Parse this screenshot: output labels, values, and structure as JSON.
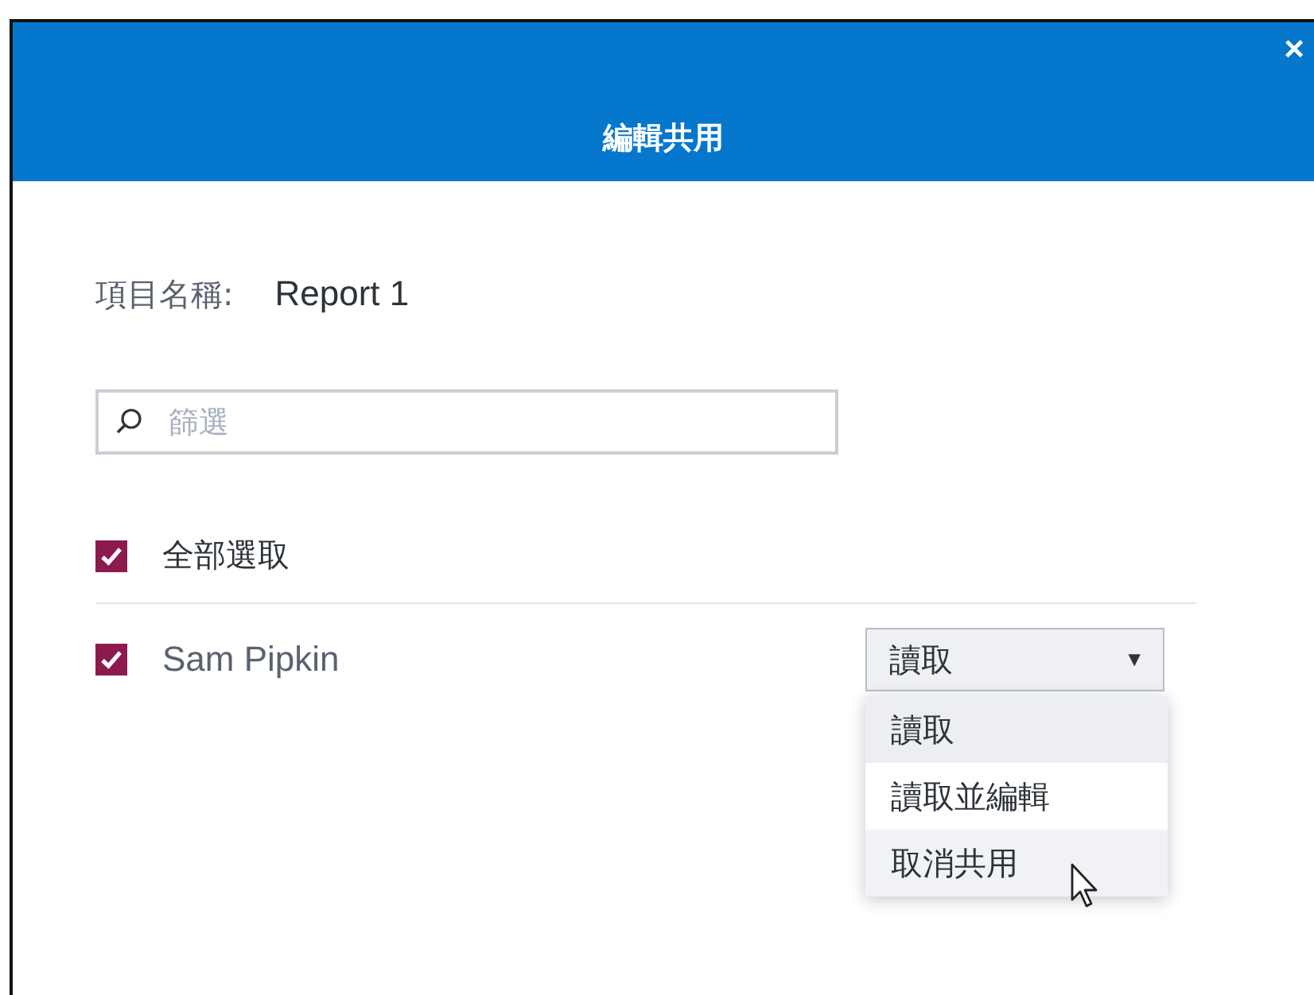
{
  "dialog": {
    "title": "編輯共用",
    "close": "×"
  },
  "item_name": {
    "label": "項目名稱:",
    "value": "Report 1"
  },
  "filter": {
    "placeholder": "篩選"
  },
  "select_all": {
    "label": "全部選取",
    "checked": true
  },
  "users": [
    {
      "name": "Sam Pipkin",
      "checked": true,
      "permission": "讀取",
      "caret": "▼",
      "expanded": true,
      "options": [
        {
          "label": "讀取",
          "selected": true,
          "hovered": false
        },
        {
          "label": "讀取並編輯",
          "selected": false,
          "hovered": false
        },
        {
          "label": "取消共用",
          "selected": false,
          "hovered": true
        }
      ]
    }
  ]
}
